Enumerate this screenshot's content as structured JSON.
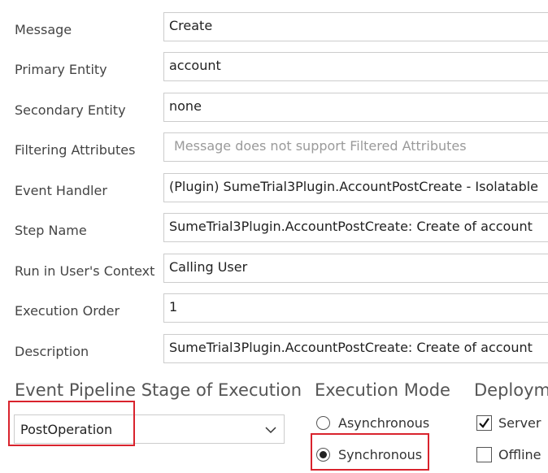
{
  "fields": [
    {
      "label": "Message",
      "value": "Create"
    },
    {
      "label": "Primary Entity",
      "value": "account"
    },
    {
      "label": "Secondary Entity",
      "value": "none"
    },
    {
      "label": "Filtering Attributes",
      "placeholder": "Message does not support Filtered Attributes"
    },
    {
      "label": "Event Handler",
      "value": "(Plugin) SumeTrial3Plugin.AccountPostCreate - Isolatable"
    },
    {
      "label": "Step Name",
      "value": "SumeTrial3Plugin.AccountPostCreate: Create of account"
    },
    {
      "label": "Run in User's Context",
      "value": "Calling User"
    },
    {
      "label": "Execution Order",
      "value": "1"
    },
    {
      "label": "Description",
      "value": "SumeTrial3Plugin.AccountPostCreate: Create of account"
    }
  ],
  "pipeline": {
    "title": "Event Pipeline Stage of Execution",
    "selected": "PostOperation"
  },
  "execution_mode": {
    "title": "Execution Mode",
    "options": [
      {
        "label": "Asynchronous",
        "selected": false
      },
      {
        "label": "Synchronous",
        "selected": true
      }
    ]
  },
  "deployment": {
    "title": "Deploym",
    "options": [
      {
        "label": "Server",
        "checked": true
      },
      {
        "label": "Offline",
        "checked": false
      }
    ]
  },
  "colors": {
    "highlight": "#d9232d"
  }
}
